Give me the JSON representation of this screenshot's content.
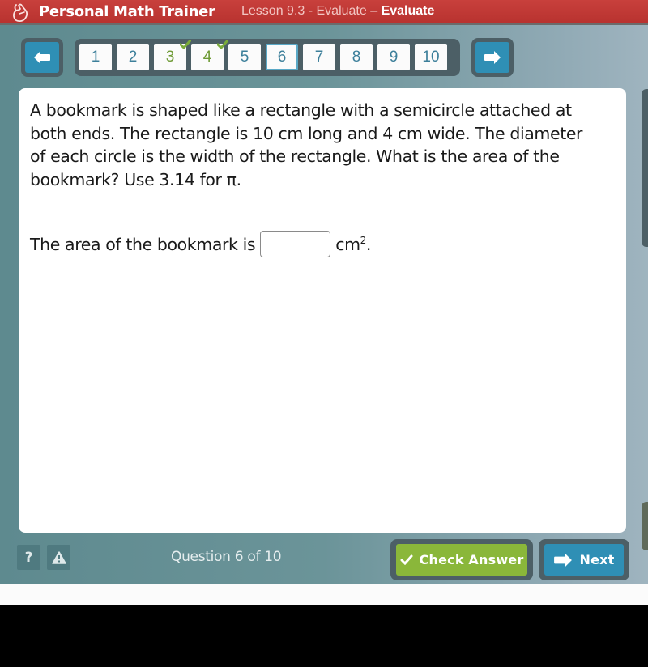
{
  "header": {
    "brand": "Personal Math Trainer",
    "lesson_prefix": "Lesson 9.3 - Evaluate",
    "separator": " – ",
    "section": "Evaluate",
    "logo_icon": "hand-logo-icon"
  },
  "nav": {
    "prev_icon": "arrow-left-icon",
    "next_icon": "arrow-right-icon",
    "questions": [
      {
        "label": "1",
        "status": "unanswered"
      },
      {
        "label": "2",
        "status": "unanswered"
      },
      {
        "label": "3",
        "status": "completed"
      },
      {
        "label": "4",
        "status": "completed"
      },
      {
        "label": "5",
        "status": "unanswered"
      },
      {
        "label": "6",
        "status": "current"
      },
      {
        "label": "7",
        "status": "unanswered"
      },
      {
        "label": "8",
        "status": "unanswered"
      },
      {
        "label": "9",
        "status": "unanswered"
      },
      {
        "label": "10",
        "status": "unanswered"
      }
    ]
  },
  "question": {
    "text": "A bookmark is shaped like a rectangle with a semicircle attached at both ends. The rectangle is 10 cm long and 4 cm wide. The diameter of each circle is the width of the rectangle. What is the area of the bookmark? Use 3.14 for π.",
    "answer_prefix": "The area of the bookmark is",
    "answer_value": "",
    "answer_placeholder": "",
    "unit": "cm",
    "unit_exponent": "2",
    "answer_suffix": "."
  },
  "footer": {
    "help_label": "?",
    "alert_icon": "warning-icon",
    "question_count": "Question 6 of 10",
    "check_answer_label": "Check Answer",
    "next_label": "Next"
  },
  "colors": {
    "header_red": "#c8403c",
    "accent_blue": "#2f8fb5",
    "check_green": "#8ab73a",
    "completed_green": "#6e9a34",
    "number_blue": "#3c7f9a",
    "frame_dark": "#4c5f66"
  }
}
